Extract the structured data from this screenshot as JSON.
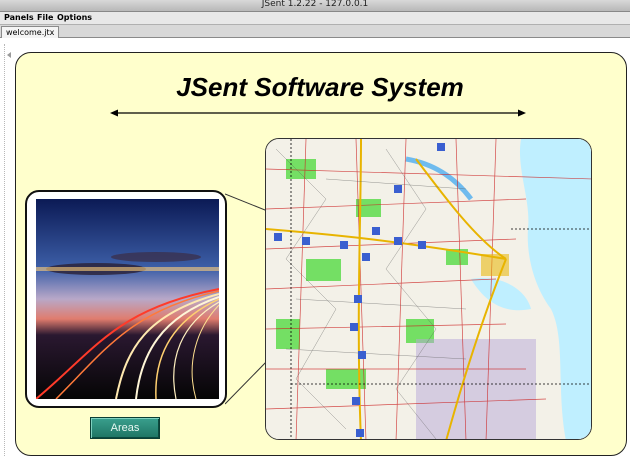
{
  "window": {
    "title": "JSent 1.2.22 - 127.0.0.1"
  },
  "menubar": {
    "items": [
      {
        "label": "Panels"
      },
      {
        "label": "File"
      },
      {
        "label": "Options"
      }
    ]
  },
  "tabs": [
    {
      "label": "welcome.jtx"
    }
  ],
  "main": {
    "title": "JSent Software System",
    "areas_button_label": "Areas"
  },
  "colors": {
    "panel_background": "#ffffcc",
    "button_teal": "#2a8a77",
    "map_sea": "#bfefff",
    "map_park": "#66dd55"
  },
  "icons": {
    "left_rail": "collapse-arrow-icon"
  }
}
